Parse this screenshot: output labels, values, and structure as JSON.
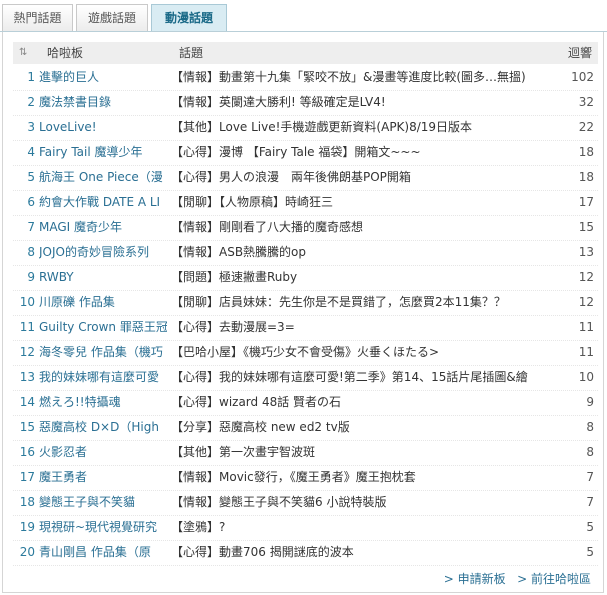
{
  "tabs": [
    "熱門話題",
    "遊戲話題",
    "動漫話題"
  ],
  "header": {
    "sort_icon": "sort-arrows",
    "board": "哈啦板",
    "title": "話題",
    "replies": "迴響"
  },
  "rows": [
    {
      "num": "1",
      "board": "進擊的巨人",
      "topic": "【情報】動畫第十九集「緊咬不放」&漫畫等進度比較(圖多…無搵)",
      "replies": "102"
    },
    {
      "num": "2",
      "board": "魔法禁書目錄",
      "topic": "【情報】英闌達大勝利! 等級確定是LV4!",
      "replies": "32"
    },
    {
      "num": "3",
      "board": "LoveLive!",
      "topic": "【其他】Love Live!手機遊戲更新資料(APK)8/19日版本",
      "replies": "22"
    },
    {
      "num": "4",
      "board": "Fairy Tail 魔導少年",
      "topic": "【心得】漫博 【Fairy Tale 福袋】開箱文~~~",
      "replies": "18"
    },
    {
      "num": "5",
      "board": "航海王 One Piece（漫",
      "topic": "【心得】男人の浪漫　兩年後佛朗基POP開箱",
      "replies": "18"
    },
    {
      "num": "6",
      "board": "約會大作戰 DATE A LI",
      "topic": "【閒聊】【人物原稿】時崎狂三",
      "replies": "17"
    },
    {
      "num": "7",
      "board": "MAGI 魔奇少年",
      "topic": "【情報】剛剛看了八大播的魔奇感想",
      "replies": "15"
    },
    {
      "num": "8",
      "board": "JOJO的奇妙冒險系列",
      "topic": "【情報】ASB熱騰騰的op",
      "replies": "13"
    },
    {
      "num": "9",
      "board": "RWBY",
      "topic": "【問題】極速撇畫Ruby",
      "replies": "12"
    },
    {
      "num": "10",
      "board": "川原礫 作品集",
      "topic": "【閒聊】店員妹妹：先生你是不是買錯了，怎麼買2本11集？？",
      "replies": "12"
    },
    {
      "num": "11",
      "board": "Guilty Crown 罪惡王冠",
      "topic": "【心得】去動漫展=3=",
      "replies": "11"
    },
    {
      "num": "12",
      "board": "海冬零兒 作品集（機巧",
      "topic": "【巴哈小屋】《機巧少女不會受傷》火垂くほたる>",
      "replies": "11"
    },
    {
      "num": "13",
      "board": "我的妹妹哪有這麼可愛",
      "topic": "【心得】我的妹妹哪有這麼可愛!第二季》第14、15話片尾插圖&繪",
      "replies": "10"
    },
    {
      "num": "14",
      "board": "燃えろ!!特攝魂",
      "topic": "【心得】wizard 48話 賢者の石",
      "replies": "9"
    },
    {
      "num": "15",
      "board": "惡魔高校 D×D（High",
      "topic": "【分享】惡魔高校 new ed2 tv版",
      "replies": "8"
    },
    {
      "num": "16",
      "board": "火影忍者",
      "topic": "【其他】第一次畫宇智波斑",
      "replies": "8"
    },
    {
      "num": "17",
      "board": "魔王勇者",
      "topic": "【情報】Movic發行，《魔王勇者》魔王抱枕套",
      "replies": "7"
    },
    {
      "num": "18",
      "board": "變態王子與不笑貓",
      "topic": "【情報】變態王子與不笑貓6 小說特裝版",
      "replies": "7"
    },
    {
      "num": "19",
      "board": "現視研~現代視覺研究",
      "topic": "【塗鴉】?",
      "replies": "5"
    },
    {
      "num": "20",
      "board": "青山剛昌 作品集（原",
      "topic": "【心得】動畫706 揭開謎底的波本",
      "replies": "5"
    }
  ],
  "footer": {
    "apply": "> 申請新板",
    "go": "> 前往哈啦區"
  },
  "colors": {
    "accent": "#2a6f93",
    "active_tab": "#d9ecf3"
  }
}
